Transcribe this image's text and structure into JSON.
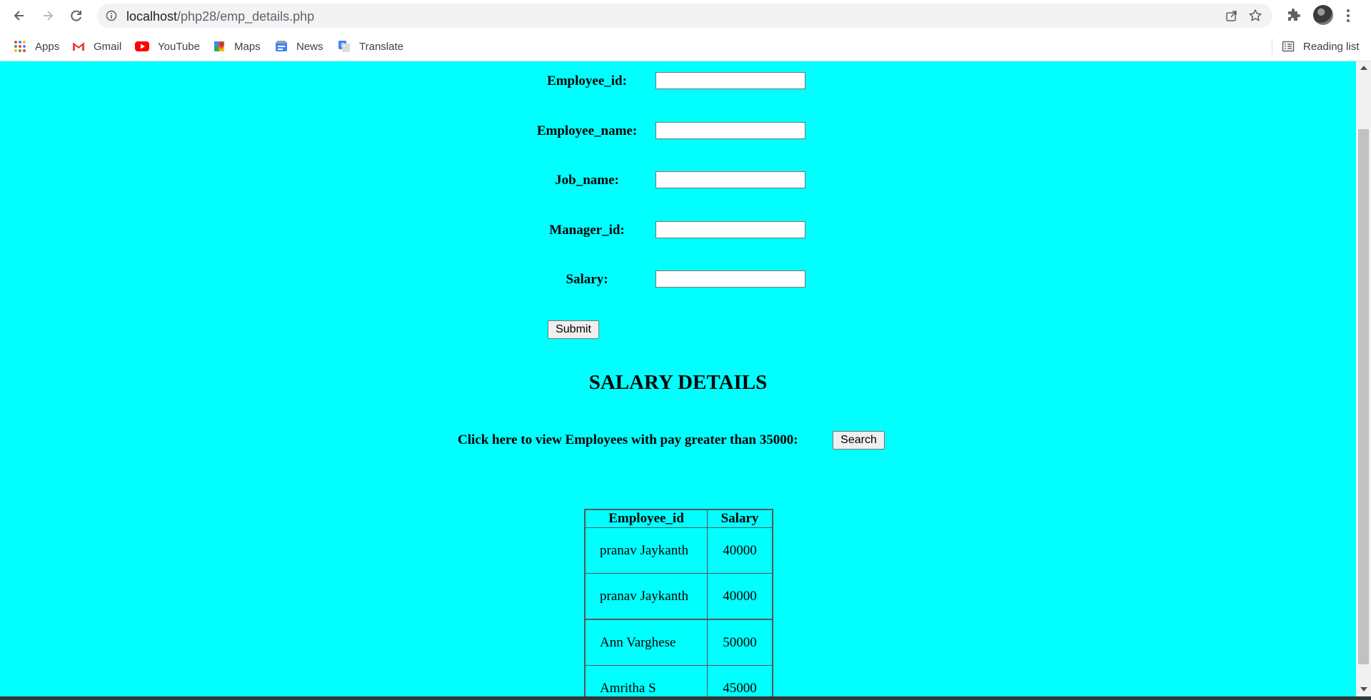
{
  "browser": {
    "url_host": "localhost",
    "url_path": "/php28/emp_details.php",
    "icons": [
      "back-icon",
      "forward-icon",
      "reload-icon",
      "info-icon",
      "share-icon",
      "star-icon",
      "extensions-icon",
      "avatar",
      "menu-icon"
    ]
  },
  "bookmarks": {
    "items": [
      {
        "label": "Apps",
        "icon": "apps-grid-icon"
      },
      {
        "label": "Gmail",
        "icon": "gmail-icon"
      },
      {
        "label": "YouTube",
        "icon": "youtube-icon"
      },
      {
        "label": "Maps",
        "icon": "maps-icon"
      },
      {
        "label": "News",
        "icon": "news-icon"
      },
      {
        "label": "Translate",
        "icon": "translate-icon"
      }
    ],
    "reading_list": "Reading list"
  },
  "form": {
    "fields": [
      {
        "label": "Employee_id:",
        "value": ""
      },
      {
        "label": "Employee_name:",
        "value": ""
      },
      {
        "label": "Job_name:",
        "value": ""
      },
      {
        "label": "Manager_id:",
        "value": ""
      },
      {
        "label": "Salary:",
        "value": ""
      }
    ],
    "submit_label": "Submit"
  },
  "salary": {
    "heading": "SALARY DETAILS",
    "search_prompt": "Click here to view Employees with pay greater than 35000:",
    "search_label": "Search",
    "table": {
      "headers": [
        "Employee_id",
        "Salary"
      ],
      "rows": [
        [
          "pranav Jaykanth",
          "40000"
        ],
        [
          "pranav Jaykanth",
          "40000"
        ],
        [
          "Ann Varghese",
          "50000"
        ],
        [
          "Amritha S",
          "45000"
        ]
      ]
    }
  },
  "colors": {
    "page_background": "#00ffff",
    "omnibox": "#f1f3f4"
  }
}
